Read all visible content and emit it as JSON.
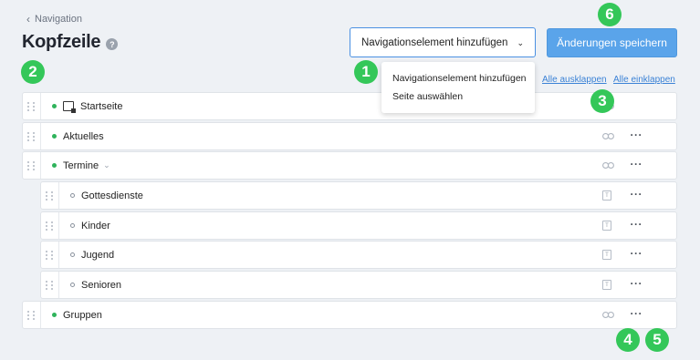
{
  "breadcrumb": {
    "label": "Navigation",
    "icon": "chevron-left-icon"
  },
  "page": {
    "title": "Kopfzeile",
    "help_icon": "?"
  },
  "toolbar": {
    "add_label": "Navigationselement hinzufügen",
    "save_label": "Änderungen speichern"
  },
  "add_menu": {
    "items": [
      "Navigationselement hinzufügen",
      "Seite auswählen"
    ]
  },
  "actions": {
    "expand_all": "Alle ausklappen",
    "collapse_all": "Alle einklappen"
  },
  "badges": [
    "1",
    "2",
    "3",
    "4",
    "5",
    "6"
  ],
  "colors": {
    "accent": "#4a90e2",
    "save_button": "#5aa4ea",
    "badge": "#34c759",
    "status_dot": "#2fb35b"
  },
  "nav_items": [
    {
      "label": "Startseite",
      "level": 0,
      "icon": "home-page-icon",
      "action_icon": "link-icon"
    },
    {
      "label": "Aktuelles",
      "level": 0,
      "action_icon": "link-icon"
    },
    {
      "label": "Termine",
      "level": 0,
      "expanded": true,
      "action_icon": "link-icon"
    },
    {
      "label": "Gottesdienste",
      "level": 1,
      "action_icon": "text-page-icon"
    },
    {
      "label": "Kinder",
      "level": 1,
      "action_icon": "text-page-icon"
    },
    {
      "label": "Jugend",
      "level": 1,
      "action_icon": "text-page-icon"
    },
    {
      "label": "Senioren",
      "level": 1,
      "action_icon": "text-page-icon"
    },
    {
      "label": "Gruppen",
      "level": 0,
      "action_icon": "link-icon"
    }
  ]
}
